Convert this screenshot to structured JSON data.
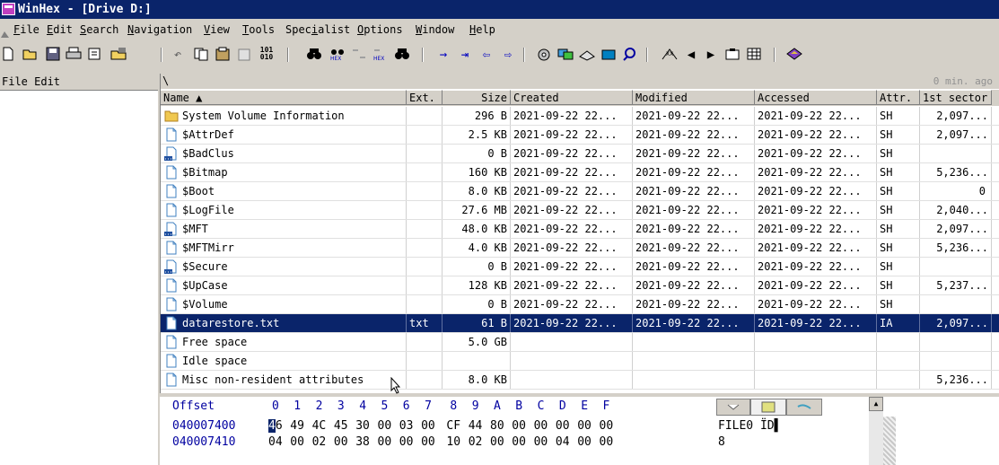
{
  "window": {
    "title": "WinHex - [Drive D:]"
  },
  "menu": [
    "File",
    "Edit",
    "Search",
    "Navigation",
    "View",
    "Tools",
    "Specialist",
    "Options",
    "Window",
    "Help"
  ],
  "menu_underline": [
    "F",
    "E",
    "S",
    "N",
    "V",
    "T",
    "i",
    "O",
    "W",
    "H"
  ],
  "toolbar": {
    "icons": [
      "new-file-icon",
      "open-folder-icon",
      "save-icon",
      "print-icon",
      "properties-icon",
      "open-disk-icon",
      "undo-icon",
      "copy-icon",
      "cut-clipboard-icon",
      "paste-icon",
      "binary-icon",
      "find-icon",
      "find-hex-icon",
      "replace-icon",
      "replace-hex-icon",
      "find-again-icon",
      "goto-offset-icon",
      "goto-sector-icon",
      "back-icon",
      "forward-icon",
      "disk-editor-icon",
      "ram-editor-icon",
      "disk-icon",
      "calculator-icon",
      "zoom-icon",
      "snapshot-icon",
      "prev-icon",
      "next-icon",
      "camera-icon",
      "grid-icon",
      "help-icon"
    ],
    "binary_label": "101\n010"
  },
  "left_pane": {
    "label": "File Edit"
  },
  "path": {
    "current": "\\",
    "updated": "0 min. ago"
  },
  "columns": [
    "Name ▲",
    "Ext.",
    "Size",
    "Created",
    "Modified",
    "Accessed",
    "Attr.",
    "1st sector"
  ],
  "rows": [
    {
      "name": "System Volume Information",
      "ext": "",
      "size": "296 B",
      "created": "2021-09-22  22...",
      "modified": "2021-09-22  22...",
      "accessed": "2021-09-22  22...",
      "attr": "SH",
      "sector": "2,097...",
      "icon": "folder"
    },
    {
      "name": "$AttrDef",
      "ext": "",
      "size": "2.5 KB",
      "created": "2021-09-22  22...",
      "modified": "2021-09-22  22...",
      "accessed": "2021-09-22  22...",
      "attr": "SH",
      "sector": "2,097...",
      "icon": "file"
    },
    {
      "name": "$BadClus",
      "ext": "",
      "size": "0 B",
      "created": "2021-09-22  22...",
      "modified": "2021-09-22  22...",
      "accessed": "2021-09-22  22...",
      "attr": "SH",
      "sector": "",
      "icon": "file-dots"
    },
    {
      "name": "$Bitmap",
      "ext": "",
      "size": "160 KB",
      "created": "2021-09-22  22...",
      "modified": "2021-09-22  22...",
      "accessed": "2021-09-22  22...",
      "attr": "SH",
      "sector": "5,236...",
      "icon": "file"
    },
    {
      "name": "$Boot",
      "ext": "",
      "size": "8.0 KB",
      "created": "2021-09-22  22...",
      "modified": "2021-09-22  22...",
      "accessed": "2021-09-22  22...",
      "attr": "SH",
      "sector": "0",
      "icon": "file"
    },
    {
      "name": "$LogFile",
      "ext": "",
      "size": "27.6 MB",
      "created": "2021-09-22  22...",
      "modified": "2021-09-22  22...",
      "accessed": "2021-09-22  22...",
      "attr": "SH",
      "sector": "2,040...",
      "icon": "file"
    },
    {
      "name": "$MFT",
      "ext": "",
      "size": "48.0 KB",
      "created": "2021-09-22  22...",
      "modified": "2021-09-22  22...",
      "accessed": "2021-09-22  22...",
      "attr": "SH",
      "sector": "2,097...",
      "icon": "file-dots"
    },
    {
      "name": "$MFTMirr",
      "ext": "",
      "size": "4.0 KB",
      "created": "2021-09-22  22...",
      "modified": "2021-09-22  22...",
      "accessed": "2021-09-22  22...",
      "attr": "SH",
      "sector": "5,236...",
      "icon": "file"
    },
    {
      "name": "$Secure",
      "ext": "",
      "size": "0 B",
      "created": "2021-09-22  22...",
      "modified": "2021-09-22  22...",
      "accessed": "2021-09-22  22...",
      "attr": "SH",
      "sector": "",
      "icon": "file-dots"
    },
    {
      "name": "$UpCase",
      "ext": "",
      "size": "128 KB",
      "created": "2021-09-22  22...",
      "modified": "2021-09-22  22...",
      "accessed": "2021-09-22  22...",
      "attr": "SH",
      "sector": "5,237...",
      "icon": "file"
    },
    {
      "name": "$Volume",
      "ext": "",
      "size": "0 B",
      "created": "2021-09-22  22...",
      "modified": "2021-09-22  22...",
      "accessed": "2021-09-22  22...",
      "attr": "SH",
      "sector": "",
      "icon": "file"
    },
    {
      "name": "datarestore.txt",
      "ext": "txt",
      "size": "61 B",
      "created": "2021-09-22  22...",
      "modified": "2021-09-22  22...",
      "accessed": "2021-09-22  22...",
      "attr": "IA",
      "sector": "2,097...",
      "icon": "file",
      "selected": true
    },
    {
      "name": "Free space",
      "ext": "",
      "size": "5.0 GB",
      "created": "",
      "modified": "",
      "accessed": "",
      "attr": "",
      "sector": "",
      "icon": "file"
    },
    {
      "name": "Idle space",
      "ext": "",
      "size": "",
      "created": "",
      "modified": "",
      "accessed": "",
      "attr": "",
      "sector": "",
      "icon": "file"
    },
    {
      "name": "Misc non-resident attributes",
      "ext": "",
      "size": "8.0 KB",
      "created": "",
      "modified": "",
      "accessed": "",
      "attr": "",
      "sector": "5,236...",
      "icon": "file"
    }
  ],
  "hex": {
    "offset_label": "Offset",
    "columns": [
      "0",
      "1",
      "2",
      "3",
      "4",
      "5",
      "6",
      "7",
      "8",
      "9",
      "A",
      "B",
      "C",
      "D",
      "E",
      "F"
    ],
    "lines": [
      {
        "offset": "040007400",
        "bytes": [
          "46",
          "49",
          "4C",
          "45",
          "30",
          "00",
          "03",
          "00",
          "CF",
          "44",
          "80",
          "00",
          "00",
          "00",
          "00",
          "00"
        ],
        "ascii": "FILE0   ÏD▌"
      },
      {
        "offset": "040007410",
        "bytes": [
          "04",
          "00",
          "02",
          "00",
          "38",
          "00",
          "00",
          "00",
          "10",
          "02",
          "00",
          "00",
          "00",
          "04",
          "00",
          "00"
        ],
        "ascii": "    8"
      }
    ]
  },
  "colors": {
    "title_bg": "#0a246a",
    "selection": "#0a246a",
    "face": "#d4d0c8",
    "offset_text": "#0000a0"
  }
}
